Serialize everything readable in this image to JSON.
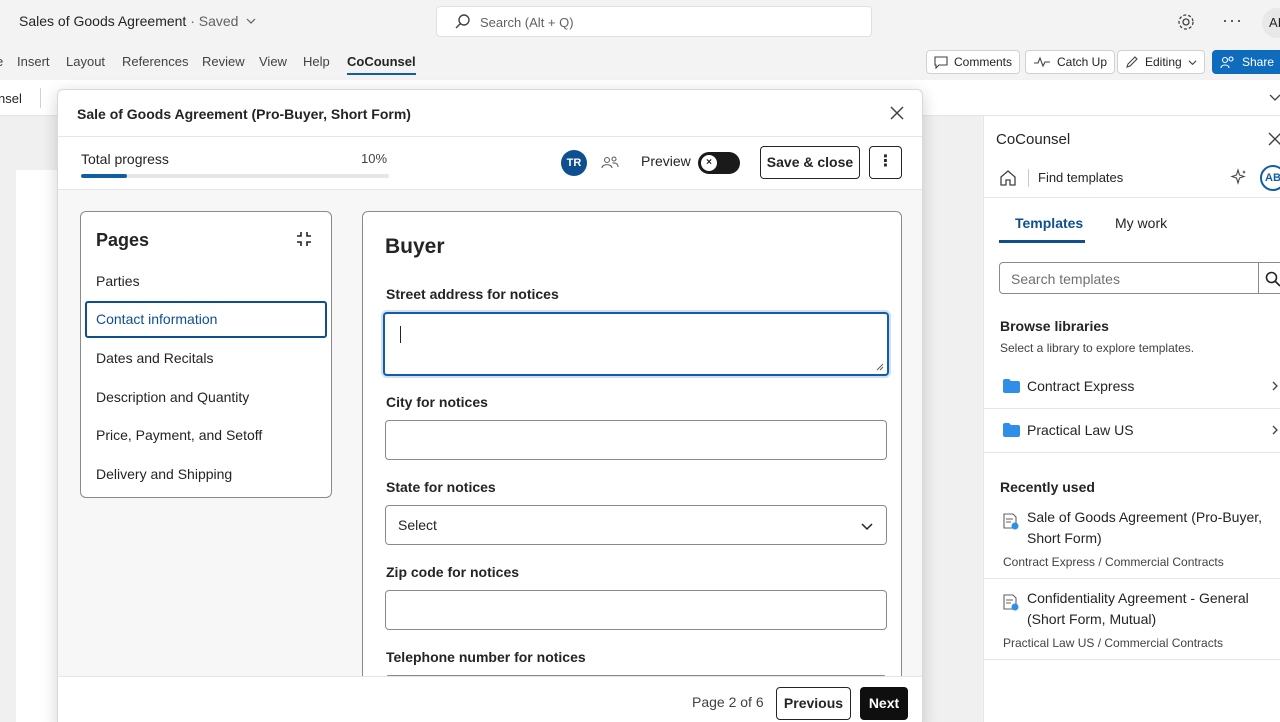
{
  "titlebar": {
    "doc_name": "Sales of Goods Agreement",
    "saved_status": " · Saved",
    "search_placeholder": "Search (Alt + Q)",
    "avatar_initials": "AI",
    "more_glyph": "···"
  },
  "ribbon": {
    "tabs": [
      "e",
      "Insert",
      "Layout",
      "References",
      "Review",
      "View",
      "Help",
      "CoCounsel"
    ],
    "active_tab": "CoCounsel",
    "buttons": {
      "comments": "Comments",
      "catch_up": "Catch Up",
      "editing": "Editing",
      "share": "Share"
    }
  },
  "toolstrip": {
    "label": "nsel"
  },
  "dialog": {
    "title": "Sale of Goods Agreement (Pro-Buyer, Short Form)",
    "progress": {
      "label": "Total progress",
      "percent_text": "10%",
      "fraction": 0.15
    },
    "collaborator_initials": "TR",
    "preview_label": "Preview",
    "save_close_label": "Save & close",
    "kebab_glyph": "⋮",
    "pages": {
      "title": "Pages",
      "items": [
        "Parties",
        "Contact information",
        "Dates and Recitals",
        "Description and Quantity",
        "Price, Payment, and Setoff",
        "Delivery and Shipping"
      ],
      "active_index": 1
    },
    "form": {
      "heading": "Buyer",
      "fields": {
        "street": {
          "label": "Street address for notices",
          "value": ""
        },
        "city": {
          "label": "City for notices",
          "value": ""
        },
        "state": {
          "label": "State for notices",
          "value": "Select"
        },
        "zip": {
          "label": "Zip code for notices",
          "value": ""
        },
        "phone": {
          "label": "Telephone number for notices",
          "value": ""
        }
      }
    },
    "footer": {
      "page_indicator": "Page 2 of 6",
      "previous_label": "Previous",
      "next_label": "Next"
    }
  },
  "sidepanel": {
    "title": "CoCounsel",
    "find_templates": "Find templates",
    "avatar_initials": "AB",
    "tabs": [
      "Templates",
      "My work"
    ],
    "search_placeholder": "Search templates",
    "browse_heading": "Browse libraries",
    "browse_sub": "Select a library to explore templates.",
    "libraries": [
      "Contract Express",
      "Practical Law US"
    ],
    "recent_heading": "Recently used",
    "recent": [
      {
        "name": "Sale of Goods Agreement (Pro-Buyer, Short Form)",
        "path": "Contract Express / Commercial Contracts"
      },
      {
        "name": "Confidentiality Agreement - General (Short Form, Mutual)",
        "path": "Practical Law US / Commercial Contracts"
      }
    ]
  },
  "colors": {
    "accent": "#115ea3",
    "share_blue": "#0f6cbd",
    "folder_blue": "#2f8fe8",
    "next_button": "#0f0f0f"
  }
}
